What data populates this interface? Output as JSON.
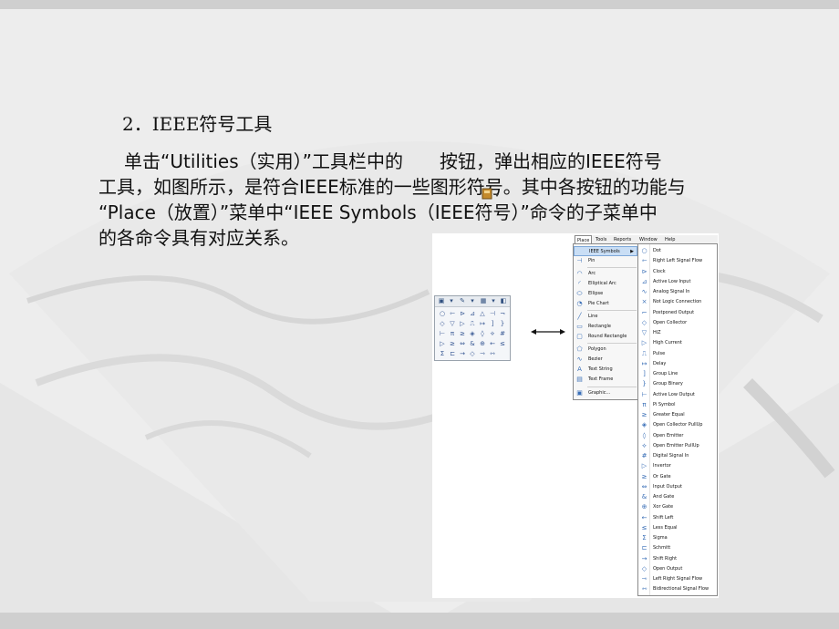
{
  "slide": {
    "heading": "2．IEEE符号工具",
    "lines": [
      "单击“Utilities（实用）”工具栏中的　　按钮，弹出相应的IEEE符号",
      "工具，如图所示，是符合IEEE标准的一些图形符号。其中各按钮的功能与",
      "“Place（放置）”菜单中“IEEE Symbols（IEEE符号）”命令的子菜单中",
      "的各命令具有对应关系。"
    ]
  },
  "menubar": [
    "Place",
    "Tools",
    "Reports",
    "Window",
    "Help"
  ],
  "place_menu": {
    "items": [
      {
        "label": "IEEE Symbols",
        "icon": "ieee-symbols-icon",
        "glyph": "",
        "submenu": true,
        "highlighted": true
      },
      {
        "label": "Pin",
        "icon": "pin-icon",
        "glyph": "⊣"
      },
      {
        "label": "Arc",
        "icon": "arc-icon",
        "glyph": "◠"
      },
      {
        "label": "Elliptical Arc",
        "icon": "elliptical-arc-icon",
        "glyph": "◜"
      },
      {
        "label": "Ellipse",
        "icon": "ellipse-icon",
        "glyph": "⬭"
      },
      {
        "label": "Pie Chart",
        "icon": "pie-chart-icon",
        "glyph": "◔"
      },
      {
        "label": "Line",
        "icon": "line-icon",
        "glyph": "╱"
      },
      {
        "label": "Rectangle",
        "icon": "rectangle-icon",
        "glyph": "▭"
      },
      {
        "label": "Round Rectangle",
        "icon": "round-rectangle-icon",
        "glyph": "▢"
      },
      {
        "label": "Polygon",
        "icon": "polygon-icon",
        "glyph": "⬠"
      },
      {
        "label": "Bezier",
        "icon": "bezier-icon",
        "glyph": "∿"
      },
      {
        "label": "Text String",
        "icon": "text-string-icon",
        "glyph": "A"
      },
      {
        "label": "Text Frame",
        "icon": "text-frame-icon",
        "glyph": "▤"
      },
      {
        "label": "Graphic...",
        "icon": "graphic-icon",
        "glyph": "▣"
      }
    ]
  },
  "ieee_submenu": {
    "items": [
      {
        "label": "Dot",
        "icon": "dot-icon",
        "glyph": "○"
      },
      {
        "label": "Right Left Signal Flow",
        "icon": "right-left-signal-flow-icon",
        "glyph": "⇽"
      },
      {
        "label": "Clock",
        "icon": "clock-icon",
        "glyph": "⊳"
      },
      {
        "label": "Active Low Input",
        "icon": "active-low-input-icon",
        "glyph": "⊿"
      },
      {
        "label": "Analog Signal In",
        "icon": "analog-signal-in-icon",
        "glyph": "∿"
      },
      {
        "label": "Not Logic Connection",
        "icon": "not-logic-connection-icon",
        "glyph": "×"
      },
      {
        "label": "Postponed Output",
        "icon": "postponed-output-icon",
        "glyph": "⌐"
      },
      {
        "label": "Open Collector",
        "icon": "open-collector-icon",
        "glyph": "◇"
      },
      {
        "label": "HiZ",
        "icon": "hiz-icon",
        "glyph": "▽"
      },
      {
        "label": "High Current",
        "icon": "high-current-icon",
        "glyph": "▷"
      },
      {
        "label": "Pulse",
        "icon": "pulse-icon",
        "glyph": "⎍"
      },
      {
        "label": "Delay",
        "icon": "delay-icon",
        "glyph": "↦"
      },
      {
        "label": "Group Line",
        "icon": "group-line-icon",
        "glyph": "]"
      },
      {
        "label": "Group Binary",
        "icon": "group-binary-icon",
        "glyph": "}"
      },
      {
        "label": "Active Low Output",
        "icon": "active-low-output-icon",
        "glyph": "⊢"
      },
      {
        "label": "Pi Symbol",
        "icon": "pi-symbol-icon",
        "glyph": "π"
      },
      {
        "label": "Greater Equal",
        "icon": "greater-equal-icon",
        "glyph": "≥"
      },
      {
        "label": "Open Collector PullUp",
        "icon": "open-collector-pullup-icon",
        "glyph": "◈"
      },
      {
        "label": "Open Emitter",
        "icon": "open-emitter-icon",
        "glyph": "◊"
      },
      {
        "label": "Open Emitter PullUp",
        "icon": "open-emitter-pullup-icon",
        "glyph": "⟡"
      },
      {
        "label": "Digital Signal In",
        "icon": "digital-signal-in-icon",
        "glyph": "#"
      },
      {
        "label": "Invertor",
        "icon": "invertor-icon",
        "glyph": "▷"
      },
      {
        "label": "Or Gate",
        "icon": "or-gate-icon",
        "glyph": "≥"
      },
      {
        "label": "Input Output",
        "icon": "input-output-icon",
        "glyph": "⇔"
      },
      {
        "label": "And Gate",
        "icon": "and-gate-icon",
        "glyph": "&"
      },
      {
        "label": "Xor Gate",
        "icon": "xor-gate-icon",
        "glyph": "⊕"
      },
      {
        "label": "Shift Left",
        "icon": "shift-left-icon",
        "glyph": "←"
      },
      {
        "label": "Less Equal",
        "icon": "less-equal-icon",
        "glyph": "≤"
      },
      {
        "label": "Sigma",
        "icon": "sigma-icon",
        "glyph": "Σ"
      },
      {
        "label": "Schmitt",
        "icon": "schmitt-icon",
        "glyph": "⊏"
      },
      {
        "label": "Shift Right",
        "icon": "shift-right-icon",
        "glyph": "→"
      },
      {
        "label": "Open Output",
        "icon": "open-output-icon",
        "glyph": "◇"
      },
      {
        "label": "Left Right Signal Flow",
        "icon": "left-right-signal-flow-icon",
        "glyph": "⇾"
      },
      {
        "label": "Bidirectional Signal Flow",
        "icon": "bidirectional-signal-flow-icon",
        "glyph": "⇿"
      }
    ]
  },
  "palette_glyphs": [
    "○",
    "⇽",
    "⊳",
    "⊿",
    "△",
    "⊣",
    "¬",
    "◇",
    "▽",
    "▷",
    "⎍",
    "↦",
    "]",
    "}",
    "⊢",
    "π",
    "≥",
    "◈",
    "◊",
    "⟡",
    "#",
    "▷",
    "≥",
    "⇔",
    "&",
    "⊕",
    "←",
    "≤",
    "Σ",
    "⊏",
    "→",
    "◇",
    "⇾",
    "⇿",
    ""
  ],
  "colors": {
    "accent": "#3a6fb7",
    "highlight": "#c9def5"
  }
}
